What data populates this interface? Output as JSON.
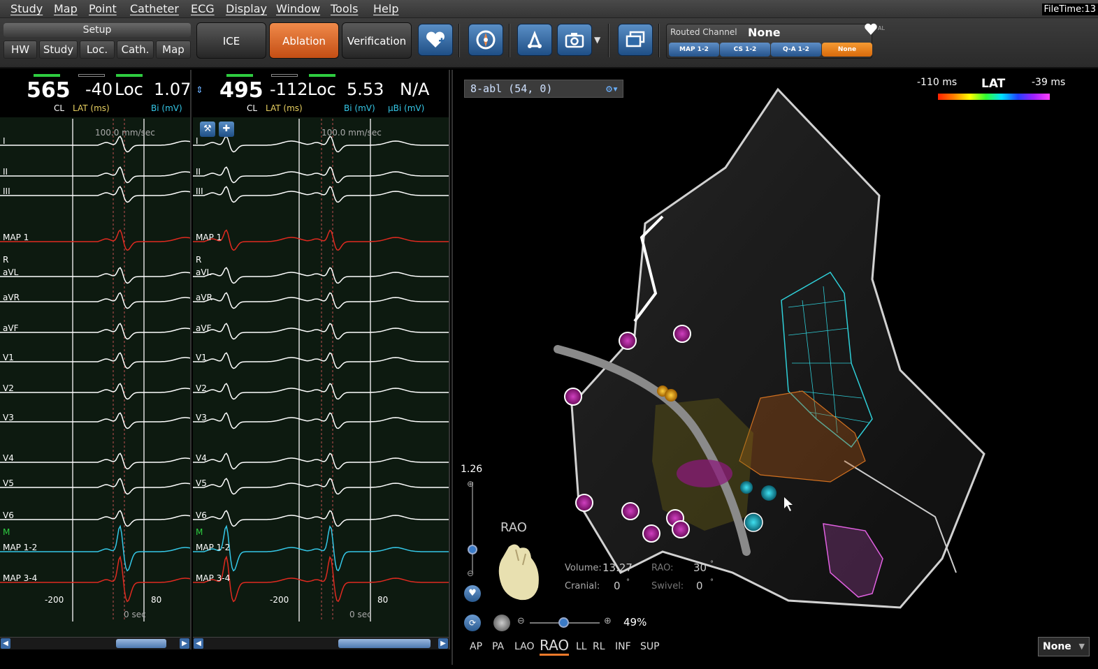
{
  "menu": [
    "Study",
    "Map",
    "Point",
    "Catheter",
    "ECG",
    "Display",
    "Window",
    "Tools",
    "Help"
  ],
  "filetime": "FileTime:13",
  "setup": {
    "title": "Setup",
    "buttons": [
      "HW",
      "Study",
      "Loc.",
      "Cath.",
      "Map"
    ]
  },
  "modes": {
    "ice": "ICE",
    "ablation": "Ablation",
    "verification": "Verification"
  },
  "routed": {
    "label": "Routed Channel",
    "value": "None",
    "channels": [
      "MAP 1-2",
      "CS 1-2",
      "Q-A 1-2",
      "None"
    ]
  },
  "left_panel": {
    "cl": "565",
    "cl_label": "CL",
    "lat": "-40",
    "lat_label": "LAT (ms)",
    "loc": "Loc",
    "bi": "1.07",
    "bi_label": "Bi (mV)",
    "speed": "100.0 mm/sec",
    "t_neg": "-200",
    "t_pos": "80",
    "t_zero": "0 sec"
  },
  "right_panel": {
    "cl": "495",
    "cl_label": "CL",
    "lat": "-112",
    "lat_label": "LAT (ms)",
    "loc": "Loc",
    "bi": "5.53",
    "bi_label": "Bi (mV)",
    "ubi": "N/A",
    "ubi_label": "µBi (mV)",
    "speed": "100.0 mm/sec",
    "t_neg": "-200",
    "t_pos": "80",
    "t_zero": "0 sec"
  },
  "traces": [
    "I",
    "II",
    "III",
    "MAP 1",
    "R",
    "aVL",
    "aVR",
    "aVF",
    "V1",
    "V2",
    "V3",
    "V4",
    "V5",
    "V6",
    "M",
    "MAP 1-2",
    "MAP 3-4"
  ],
  "map": {
    "selector": "8-abl (54, 0)",
    "lat_min": "-110 ms",
    "lat_title": "LAT",
    "lat_max": "-39 ms",
    "zoom_value": "1.26",
    "orientation": "RAO",
    "volume_label": "Volume:",
    "volume": "13.27",
    "rao_label": "RAO:",
    "rao": "30",
    "cranial_label": "Cranial:",
    "cranial": "0",
    "swivel_label": "Swivel:",
    "swivel": "0",
    "deg": "°",
    "zoom_pct": "49%",
    "views": [
      "AP",
      "PA",
      "LAO",
      "RAO",
      "LL",
      "RL",
      "INF",
      "SUP"
    ],
    "none_select": "None"
  },
  "colors": {
    "accent": "#e8702a",
    "blue": "#2f6aa8",
    "green": "#2ecc40",
    "trace_white": "#ffffff",
    "trace_red": "#e02a20",
    "trace_cyan": "#35c8e8"
  }
}
